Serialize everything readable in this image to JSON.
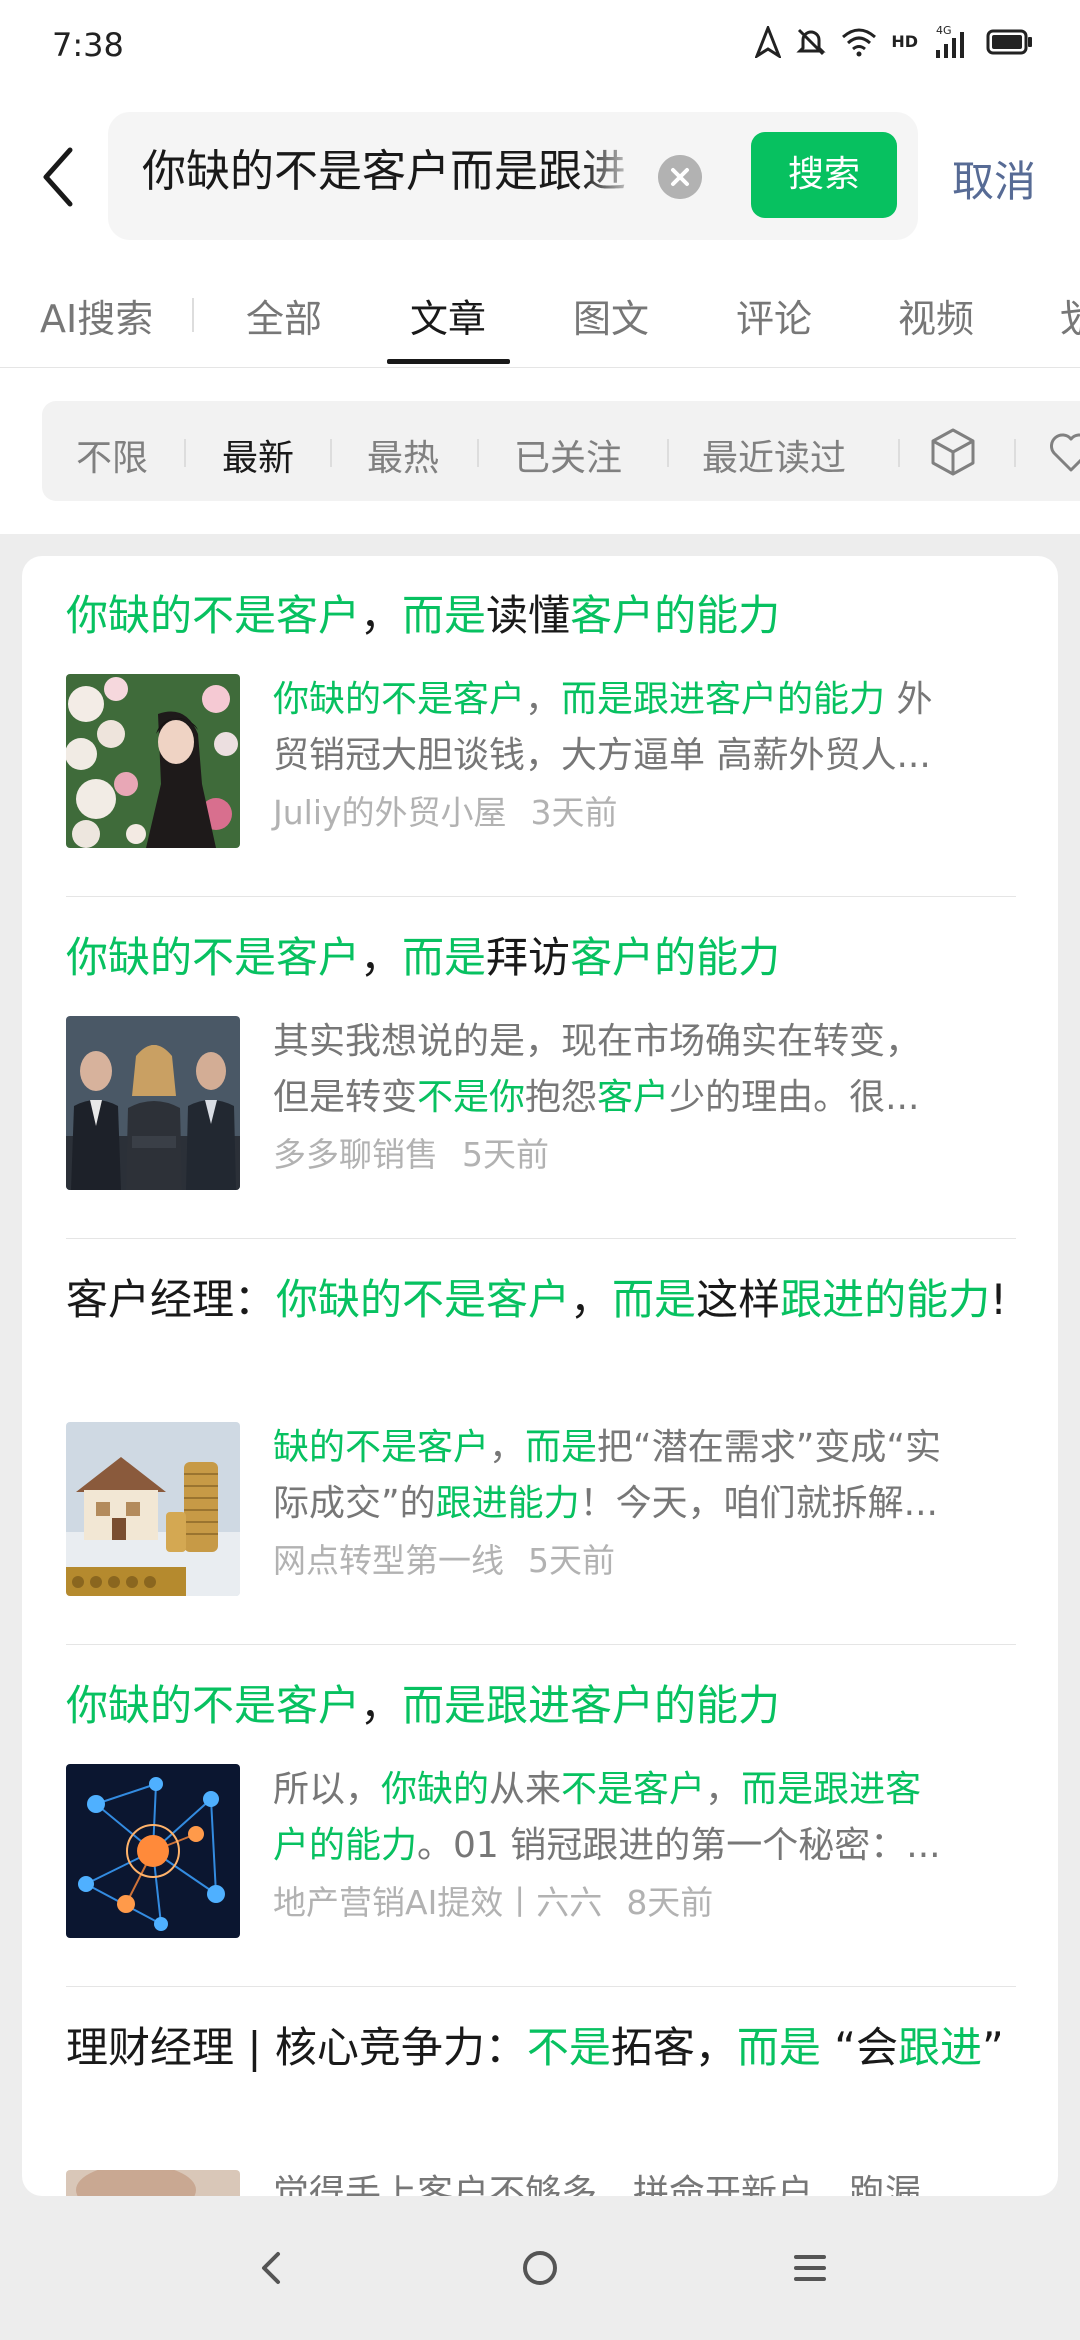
{
  "status_bar": {
    "time": "7:38",
    "network_label": "4G",
    "hd_label": "HD"
  },
  "search": {
    "query": "你缺的不是客户而是跟进",
    "button_label": "搜索",
    "cancel_label": "取消"
  },
  "tabs": [
    {
      "label": "AI搜索"
    },
    {
      "label": "全部"
    },
    {
      "label": "文章"
    },
    {
      "label": "图文"
    },
    {
      "label": "评论"
    },
    {
      "label": "视频"
    },
    {
      "label": "划"
    }
  ],
  "active_tab": "文章",
  "filters": [
    {
      "label": "不限"
    },
    {
      "label": "最新"
    },
    {
      "label": "最热"
    },
    {
      "label": "已关注"
    },
    {
      "label": "最近读过"
    }
  ],
  "active_filter": "最新",
  "results": [
    {
      "title": [
        {
          "text": "你缺的不是客户",
          "hl": true
        },
        {
          "text": "，",
          "hl": false
        },
        {
          "text": "而是",
          "hl": true
        },
        {
          "text": "读懂",
          "hl": false
        },
        {
          "text": "客户的能力",
          "hl": true
        }
      ],
      "snippet_line1": [
        {
          "text": "你缺的不是客户",
          "hl": true
        },
        {
          "text": "，",
          "hl": false
        },
        {
          "text": "而是跟进客户的能力",
          "hl": true
        },
        {
          "text": " 外",
          "hl": false
        }
      ],
      "snippet_line2": [
        {
          "text": "贸销冠大胆谈钱，大方逼单 高薪外贸人...",
          "hl": false
        }
      ],
      "source": "Juliy的外贸小屋",
      "time": "3天前",
      "thumb": "woman-with-flowers-photo"
    },
    {
      "title": [
        {
          "text": "你缺的不是客户",
          "hl": true
        },
        {
          "text": "，",
          "hl": false
        },
        {
          "text": "而是",
          "hl": true
        },
        {
          "text": "拜访",
          "hl": false
        },
        {
          "text": "客户的能力",
          "hl": true
        }
      ],
      "snippet_line1": [
        {
          "text": "其实我想说的是，现在市场确实在转变，",
          "hl": false
        }
      ],
      "snippet_line2": [
        {
          "text": "但是转变",
          "hl": false
        },
        {
          "text": "不是你",
          "hl": true
        },
        {
          "text": "抱怨",
          "hl": false
        },
        {
          "text": "客户",
          "hl": true
        },
        {
          "text": "少的理由。很...",
          "hl": false
        }
      ],
      "source": "多多聊销售",
      "time": "5天前",
      "thumb": "business-team-photo"
    },
    {
      "title": [
        {
          "text": "客户经理：",
          "hl": false
        },
        {
          "text": "你缺的不是客户",
          "hl": true
        },
        {
          "text": "，",
          "hl": false
        },
        {
          "text": "而是",
          "hl": true
        },
        {
          "text": "这样",
          "hl": false
        },
        {
          "text": "跟进的能力",
          "hl": true
        },
        {
          "text": "!",
          "hl": false
        }
      ],
      "snippet_line1": [
        {
          "text": "缺的不是客户",
          "hl": true
        },
        {
          "text": "，",
          "hl": false
        },
        {
          "text": "而是",
          "hl": true
        },
        {
          "text": "把“潜在需求”变成“实",
          "hl": false
        }
      ],
      "snippet_line2": [
        {
          "text": "际成交”的",
          "hl": false
        },
        {
          "text": "跟进能力",
          "hl": true
        },
        {
          "text": "！今天，咱们就拆解...",
          "hl": false
        }
      ],
      "source": "网点转型第一线",
      "time": "5天前",
      "thumb": "house-and-coins-photo"
    },
    {
      "title": [
        {
          "text": "你缺的不是客户",
          "hl": true
        },
        {
          "text": "，",
          "hl": false
        },
        {
          "text": "而是跟进客户的能力",
          "hl": true
        }
      ],
      "snippet_line1": [
        {
          "text": "所以，",
          "hl": false
        },
        {
          "text": "你缺的",
          "hl": true
        },
        {
          "text": "从来",
          "hl": false
        },
        {
          "text": "不是客户",
          "hl": true
        },
        {
          "text": "，",
          "hl": false
        },
        {
          "text": "而是跟进客",
          "hl": true
        }
      ],
      "snippet_line2": [
        {
          "text": "户的能力",
          "hl": true
        },
        {
          "text": "。01 销冠跟进的第一个秘密：...",
          "hl": false
        }
      ],
      "source": "地产营销AI提效丨六六",
      "time": "8天前",
      "thumb": "network-nodes-image"
    },
    {
      "title": [
        {
          "text": "理财经理 | 核心竞争力：",
          "hl": false
        },
        {
          "text": "不是",
          "hl": true
        },
        {
          "text": "拓客，",
          "hl": false
        },
        {
          "text": "而是",
          "hl": true
        },
        {
          "text": " “会",
          "hl": false
        },
        {
          "text": "跟进",
          "hl": true
        },
        {
          "text": "”",
          "hl": false
        }
      ],
      "snippet_line1": [
        {
          "text": "觉得手上客户不够多，拼命开新户，跑漏",
          "hl": false
        }
      ],
      "snippet_line2": [],
      "source": "",
      "time": "",
      "thumb": "hand-photo"
    }
  ],
  "colors": {
    "accent": "#07c160",
    "link": "#576b95"
  }
}
